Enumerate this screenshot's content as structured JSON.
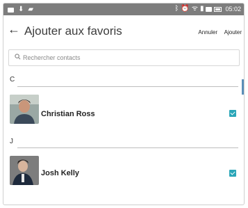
{
  "statusbar": {
    "time": "05:02"
  },
  "appbar": {
    "back": "←",
    "title": "Ajouter aux favoris",
    "cancel_label": "Annuler",
    "add_label": "Ajouter"
  },
  "search": {
    "placeholder": "Rechercher contacts"
  },
  "sections": [
    {
      "letter": "C",
      "contacts": [
        {
          "name": "Christian Ross",
          "checked": true
        }
      ]
    },
    {
      "letter": "J",
      "contacts": [
        {
          "name": "Josh Kelly",
          "checked": true
        }
      ]
    }
  ],
  "colors": {
    "statusbar_bg": "#7d7d7d",
    "accent_checkbox": "#2aa6b8",
    "scrollbar": "#5b8fb8"
  }
}
